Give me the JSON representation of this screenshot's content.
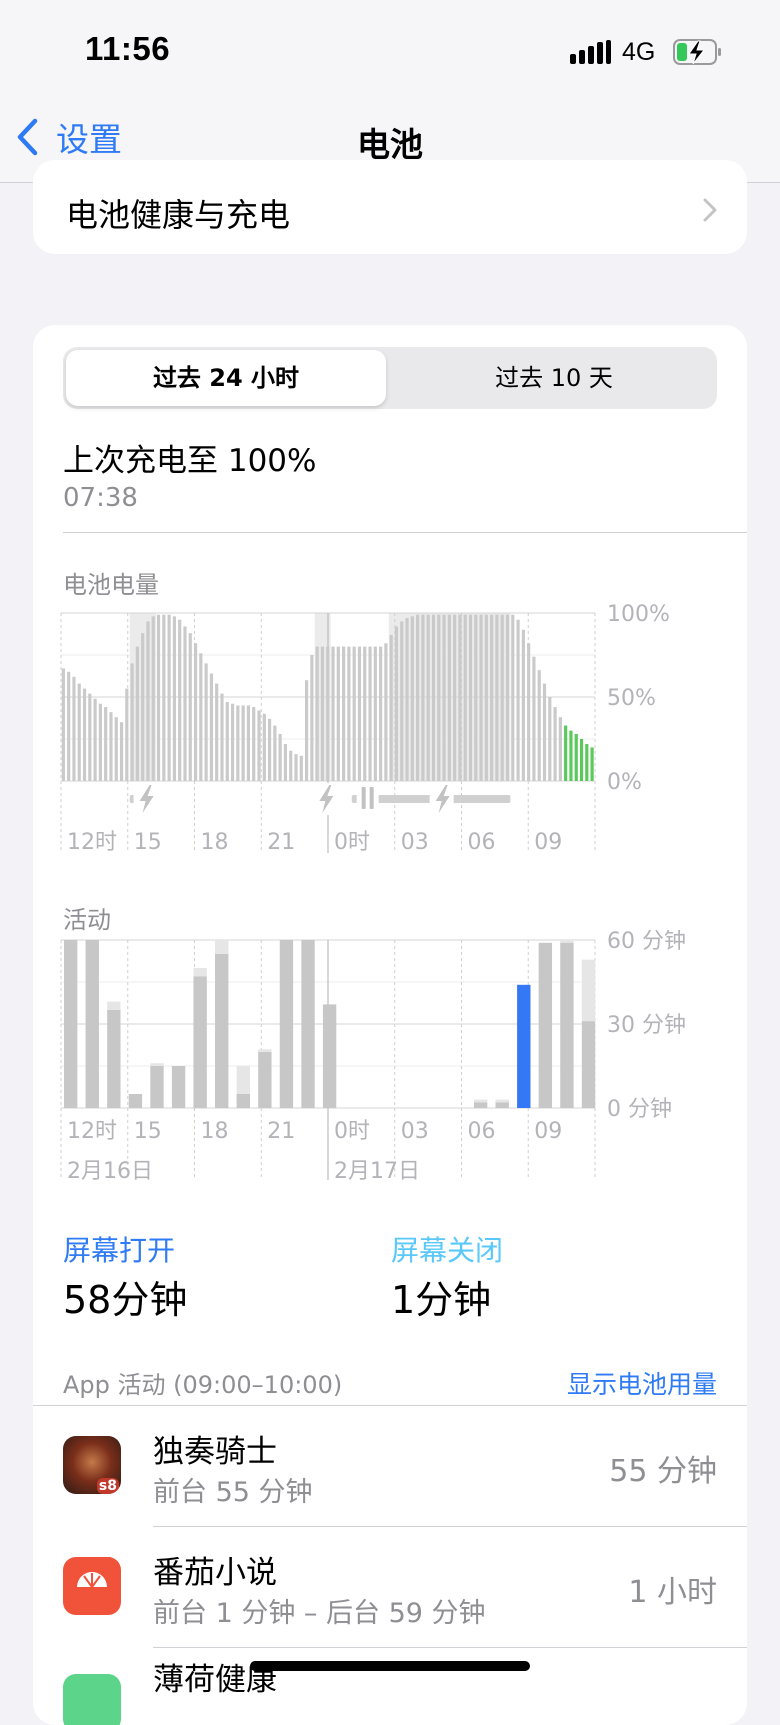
{
  "status": {
    "time": "11:56",
    "network": "4G",
    "battery_icon": "battery-charging-icon"
  },
  "nav": {
    "back_label": "设置",
    "title": "电池"
  },
  "health_row": {
    "label": "电池健康与充电"
  },
  "tabs": {
    "selected": "过去 24 小时",
    "other": "过去 10 天"
  },
  "last_charge": {
    "label": "上次充电至 100%",
    "time": "07:38"
  },
  "battery_chart": {
    "title": "电池电量",
    "y_ticks": [
      "100%",
      "50%",
      "0%"
    ],
    "x_ticks": [
      "12时",
      "15",
      "18",
      "21",
      "0时",
      "03",
      "06",
      "09"
    ]
  },
  "activity_chart": {
    "title": "活动",
    "y_ticks": [
      "60 分钟",
      "30 分钟",
      "0 分钟"
    ],
    "x_ticks": [
      "12时",
      "15",
      "18",
      "21",
      "0时",
      "03",
      "06",
      "09"
    ],
    "dates": [
      "2月16日",
      "2月17日"
    ]
  },
  "chart_data": [
    {
      "type": "bar",
      "title": "电池电量",
      "unit": "%",
      "ylim": [
        0,
        100
      ],
      "y_ticks": [
        "100%",
        "50%",
        "0%"
      ],
      "x_ticks": [
        "12时",
        "15",
        "18",
        "21",
        "0时",
        "03",
        "06",
        "09"
      ],
      "values": [
        67,
        65,
        62,
        58,
        55,
        52,
        49,
        46,
        44,
        41,
        38,
        35,
        55,
        70,
        80,
        88,
        95,
        98,
        99,
        99,
        99,
        98,
        96,
        92,
        88,
        82,
        76,
        70,
        64,
        58,
        52,
        47,
        46,
        45,
        45,
        45,
        44,
        42,
        40,
        37,
        33,
        28,
        22,
        18,
        16,
        15,
        60,
        75,
        80,
        80,
        80,
        80,
        80,
        80,
        80,
        80,
        80,
        80,
        80,
        80,
        80,
        82,
        87,
        92,
        95,
        97,
        98,
        99,
        99,
        99,
        99,
        99,
        99,
        99,
        99,
        99,
        99,
        99,
        99,
        99,
        99,
        99,
        99,
        99,
        99,
        99,
        96,
        90,
        82,
        74,
        66,
        58,
        50,
        44,
        38,
        33,
        30,
        28,
        25,
        22,
        20
      ],
      "highlight_range": [
        95,
        100
      ],
      "colors": {
        "normal": "#cacaca",
        "highlight": "#5ac85a",
        "charging_band": "#ebebeb"
      }
    },
    {
      "type": "bar",
      "title": "活动",
      "unit": "分钟",
      "ylim": [
        0,
        60
      ],
      "y_ticks": [
        "60 分钟",
        "30 分钟",
        "0 分钟"
      ],
      "x_ticks": [
        "12时",
        "15",
        "18",
        "21",
        "0时",
        "03",
        "06",
        "09"
      ],
      "dates": [
        "2月16日",
        "2月17日"
      ],
      "series": [
        {
          "name": "屏幕打开",
          "values": [
            60,
            60,
            35,
            5,
            15,
            15,
            47,
            55,
            5,
            20,
            60,
            60,
            37,
            0,
            0,
            0,
            0,
            0,
            0,
            2,
            2,
            44,
            59,
            59,
            31
          ]
        },
        {
          "name": "屏幕关闭",
          "values": [
            0,
            0,
            3,
            0,
            1,
            0,
            3,
            5,
            10,
            1,
            0,
            0,
            0,
            0,
            0,
            0,
            0,
            0,
            0,
            1,
            1,
            0,
            0,
            1,
            22
          ]
        }
      ],
      "highlight_index": 21,
      "colors": {
        "screen_on": "#c7c7c7",
        "screen_off": "#e6e6e6",
        "highlight": "#3478f6"
      }
    }
  ],
  "summary": {
    "screen_on_label": "屏幕打开",
    "screen_on_value": "58分钟",
    "screen_off_label": "屏幕关闭",
    "screen_off_value": "1分钟"
  },
  "app_activity": {
    "header": "App 活动 (09:00–10:00)",
    "show_usage": "显示电池用量",
    "apps": [
      {
        "name": "独奏骑士",
        "detail": "前台 55 分钟",
        "time": "55 分钟",
        "icon": "soul-knight-app-icon"
      },
      {
        "name": "番茄小说",
        "detail": "前台 1 分钟 – 后台 59 分钟",
        "time": "1 小时",
        "icon": "tomato-novel-app-icon"
      },
      {
        "name": "薄荷健康",
        "detail": "",
        "time": "",
        "icon": "mint-health-app-icon"
      }
    ]
  }
}
